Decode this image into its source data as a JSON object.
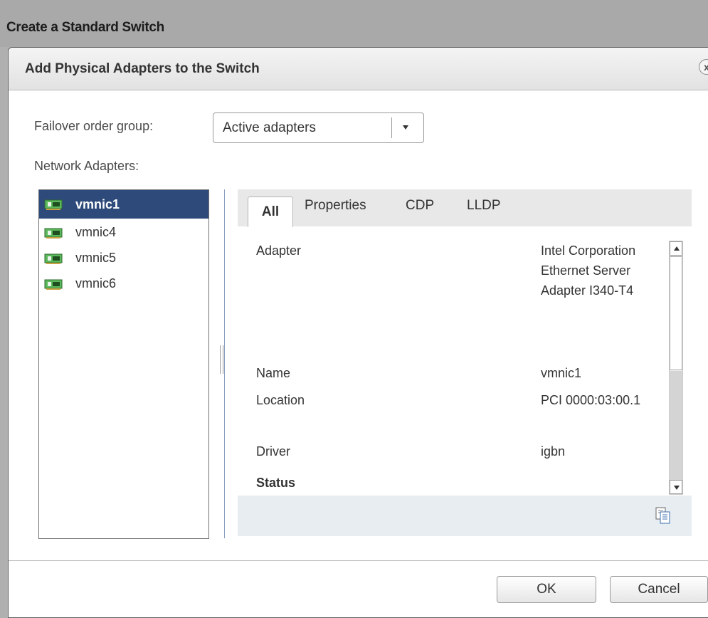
{
  "outer": {
    "title": "Create a Standard Switch"
  },
  "dialog": {
    "title": "Add Physical Adapters to the Switch",
    "close_glyph": "x",
    "failover_label": "Failover order group:",
    "failover_value": "Active adapters",
    "network_adapters_label": "Network Adapters:",
    "adapters": [
      {
        "name": "vmnic1",
        "selected": true
      },
      {
        "name": "vmnic4",
        "selected": false
      },
      {
        "name": "vmnic5",
        "selected": false
      },
      {
        "name": "vmnic6",
        "selected": false
      }
    ],
    "tabs": [
      "All",
      "Properties",
      "CDP",
      "LLDP"
    ],
    "active_tab": "All",
    "properties": {
      "adapter_label": "Adapter",
      "adapter_value": "Intel Corporation Ethernet Server Adapter I340-T4",
      "name_label": "Name",
      "name_value": "vmnic1",
      "location_label": "Location",
      "location_value": "PCI 0000:03:00.1",
      "driver_label": "Driver",
      "driver_value": "igbn",
      "status_header": "Status"
    },
    "buttons": {
      "ok": "OK",
      "cancel": "Cancel"
    }
  },
  "colors": {
    "selected_row": "#2e4a7a",
    "nic_icon": "#4caf50"
  },
  "icons": [
    "close-icon",
    "dropdown-arrow-icon",
    "network-adapter-icon",
    "copy-icon",
    "scroll-up-icon",
    "scroll-down-icon"
  ]
}
